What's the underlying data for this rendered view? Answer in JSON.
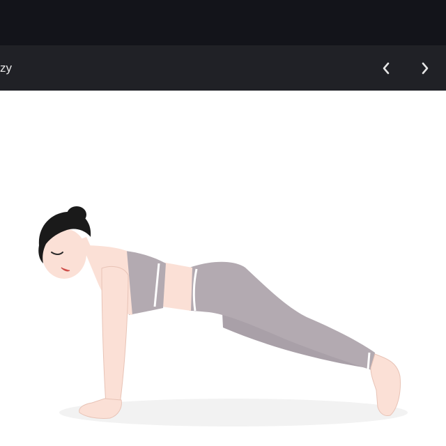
{
  "viewer": {
    "title": "zy",
    "nav": {
      "prev_icon": "chevron-left-icon",
      "next_icon": "chevron-right-icon"
    }
  },
  "image": {
    "subject": "yoga-plank-illustration",
    "colors": {
      "hair": "#1a1a1a",
      "skin": "#fbe0d6",
      "outfit": "#b3aab1",
      "outfit_stripe": "#ffffff",
      "shadow": "#f2f2f2",
      "line": "#2b2b2b"
    }
  },
  "theme": {
    "topbar_bg": "#13141a",
    "subbar_bg": "#202126",
    "icon_color": "#e6e6e6",
    "content_bg": "#ffffff"
  }
}
